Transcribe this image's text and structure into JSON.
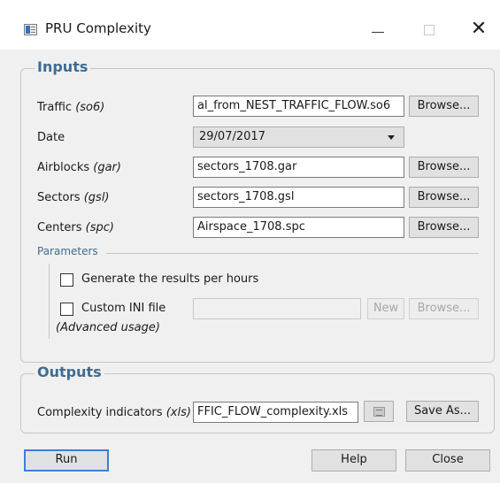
{
  "window": {
    "title": "PRU Complexity",
    "minimize": "minimize",
    "maximize": "maximize",
    "close": "close"
  },
  "inputs": {
    "legend": "Inputs",
    "traffic": {
      "label": "Traffic",
      "hint": "(so6)",
      "value": "al_from_NEST_TRAFFIC_FLOW.so6",
      "browse": "Browse..."
    },
    "date": {
      "label": "Date",
      "value": "29/07/2017"
    },
    "airblocks": {
      "label": "Airblocks",
      "hint": "(gar)",
      "value": "sectors_1708.gar",
      "browse": "Browse..."
    },
    "sectors": {
      "label": "Sectors",
      "hint": "(gsl)",
      "value": "sectors_1708.gsl",
      "browse": "Browse..."
    },
    "centers": {
      "label": "Centers",
      "hint": "(spc)",
      "value": "Airspace_1708.spc",
      "browse": "Browse..."
    },
    "parameters": {
      "legend": "Parameters",
      "per_hours": {
        "label": "Generate the results per hours",
        "checked": false
      },
      "custom_ini": {
        "label": "Custom INI file",
        "note": "(Advanced usage)",
        "value": "",
        "new": "New",
        "browse": "Browse...",
        "checked": false
      }
    }
  },
  "outputs": {
    "legend": "Outputs",
    "complexity": {
      "label": "Complexity indicators",
      "hint": "(xls)",
      "value": "FFIC_FLOW_complexity.xls",
      "icon": "spreadsheet-icon",
      "save_as": "Save As..."
    }
  },
  "footer": {
    "run": "Run",
    "help": "Help",
    "close": "Close"
  }
}
